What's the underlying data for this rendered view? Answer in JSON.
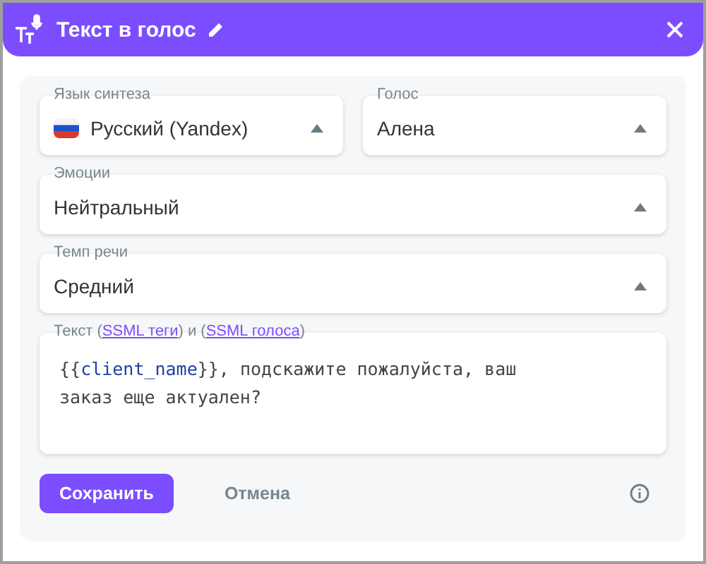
{
  "header": {
    "title": "Текст в голос"
  },
  "fields": [
    {
      "label": "Язык синтеза",
      "value": "Русский (Yandex)",
      "flag": true
    },
    {
      "label": "Голос",
      "value": "Алена"
    },
    {
      "label": "Эмоции",
      "value": "Нейтральный"
    },
    {
      "label": "Темп речи",
      "value": "Средний"
    }
  ],
  "text_field": {
    "label_parts": [
      {
        "kind": "text",
        "text": "Текст ("
      },
      {
        "kind": "link",
        "text": "SSML теги"
      },
      {
        "kind": "text",
        "text": ") и ("
      },
      {
        "kind": "link",
        "text": "SSML голоса"
      },
      {
        "kind": "text",
        "text": ")"
      }
    ],
    "value_parts": [
      {
        "kind": "text",
        "text": "{{"
      },
      {
        "kind": "variable",
        "text": "client_name"
      },
      {
        "kind": "text",
        "text": "}}, подскажите пожалуйста, ваш заказ еще актуален?"
      }
    ]
  },
  "buttons": [
    {
      "kind": "primary",
      "label": "Сохранить"
    },
    {
      "kind": "secondary",
      "label": "Отмена"
    }
  ]
}
